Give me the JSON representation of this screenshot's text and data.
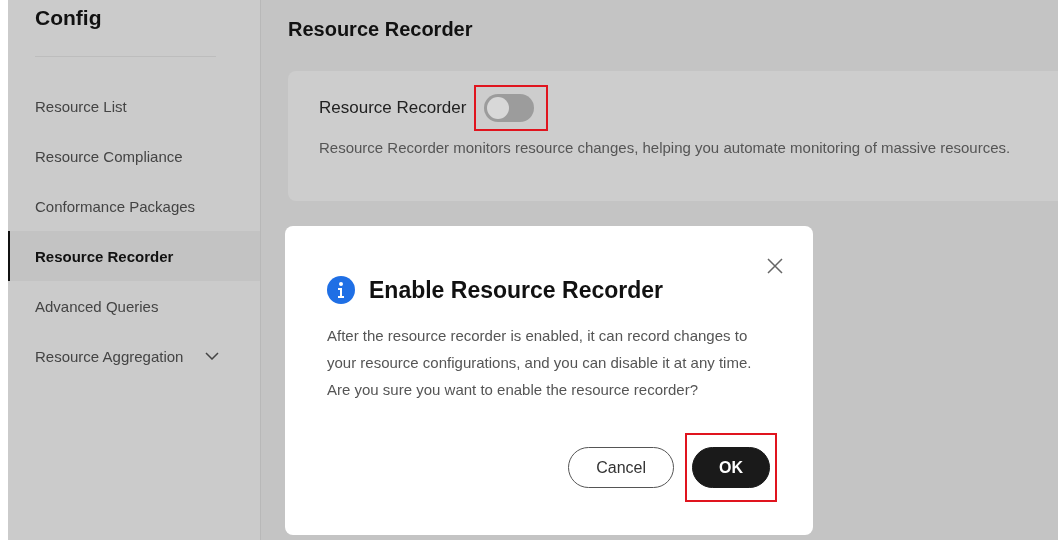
{
  "sidebar": {
    "title": "Config",
    "items": [
      {
        "label": "Resource List",
        "selected": false
      },
      {
        "label": "Resource Compliance",
        "selected": false
      },
      {
        "label": "Conformance Packages",
        "selected": false
      },
      {
        "label": "Resource Recorder",
        "selected": true
      },
      {
        "label": "Advanced Queries",
        "selected": false
      },
      {
        "label": "Resource Aggregation",
        "selected": false,
        "expanded": false
      }
    ]
  },
  "main": {
    "title": "Resource Recorder",
    "setting": {
      "label": "Resource Recorder",
      "on": false,
      "highlighted": true,
      "description": "Resource Recorder monitors resource changes, helping you automate monitoring of massive resources."
    }
  },
  "dialog": {
    "title": "Enable Resource Recorder",
    "message": "After the resource recorder is enabled, it can record changes to your resource configurations, and you can disable it at any time. Are you sure you want to enable the resource recorder?",
    "buttons": [
      {
        "label": "Cancel",
        "kind": "secondary",
        "highlighted": false
      },
      {
        "label": "OK",
        "kind": "primary",
        "highlighted": true
      }
    ]
  }
}
